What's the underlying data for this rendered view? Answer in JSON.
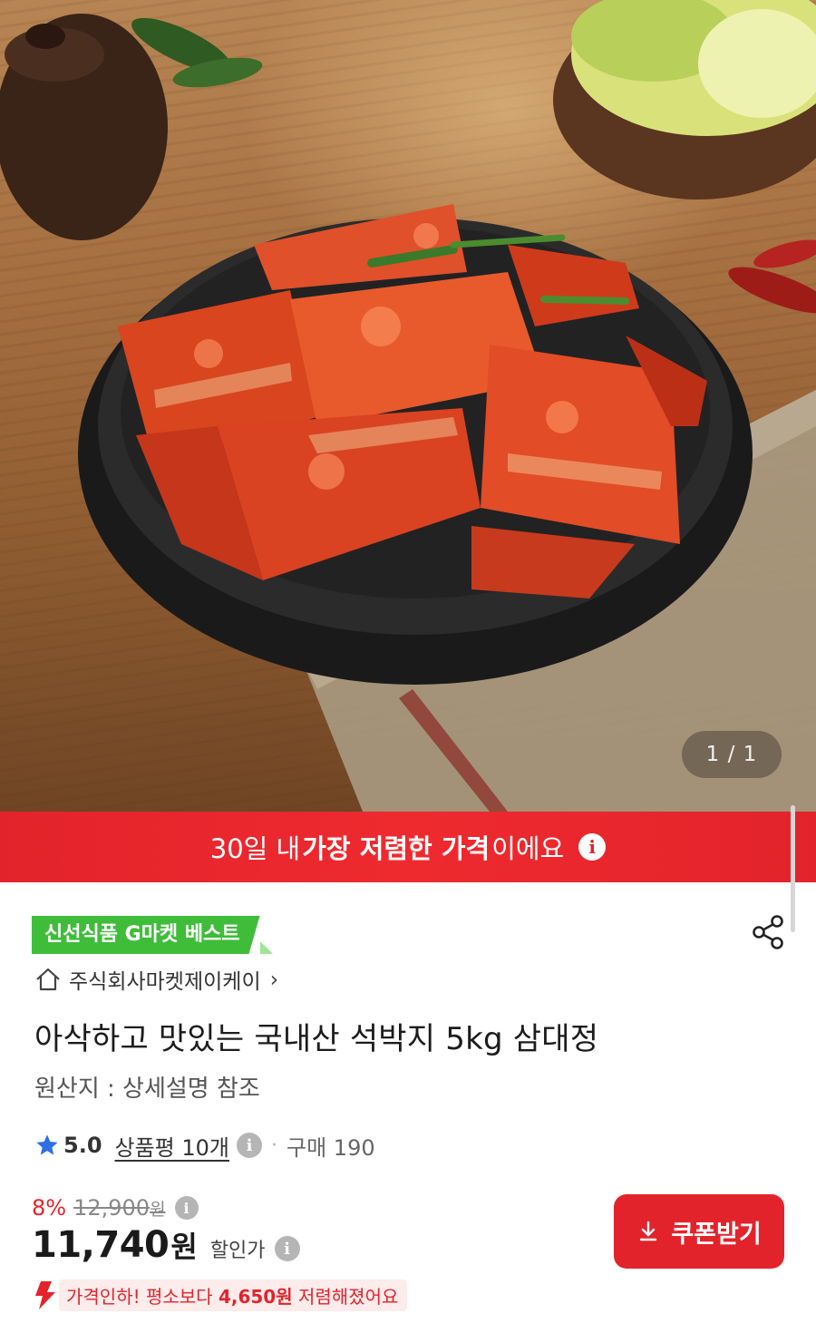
{
  "gallery": {
    "pager": "1 / 1"
  },
  "banner": {
    "text_pre": "30일 내 ",
    "text_bold": "가장 저렴한 가격",
    "text_post": "이에요",
    "info_icon": "i"
  },
  "product": {
    "badge": "신선식품 G마켓 베스트",
    "seller": "주식회사마켓제이케이",
    "seller_chevron": "›",
    "title": "아삭하고 맛있는 국내산 석박지 5kg 삼대정",
    "origin": "원산지 : 상세설명 참조"
  },
  "rating": {
    "score": "5.0",
    "reviews": "상품평 10개",
    "info_icon": "i",
    "separator": "·",
    "purchases": "구매 190"
  },
  "price": {
    "discount": "8%",
    "original": "12,900",
    "original_unit": "원",
    "sale": "11,740",
    "sale_unit": "원",
    "sale_label": "할인가",
    "info_icon": "i"
  },
  "coupon": {
    "label": "쿠폰받기"
  },
  "price_drop": {
    "lead": "가격인하!",
    "mid": " 평소보다 ",
    "amount": "4,650원",
    "tail": " 저렴해졌어요"
  },
  "colors": {
    "accent_red": "#e3232b",
    "badge_green": "#3fbd3a",
    "star_blue": "#2f6fe6"
  },
  "icons": [
    "share-icon",
    "home-icon",
    "star-icon",
    "download-icon",
    "price-down-icon",
    "info-icon"
  ]
}
